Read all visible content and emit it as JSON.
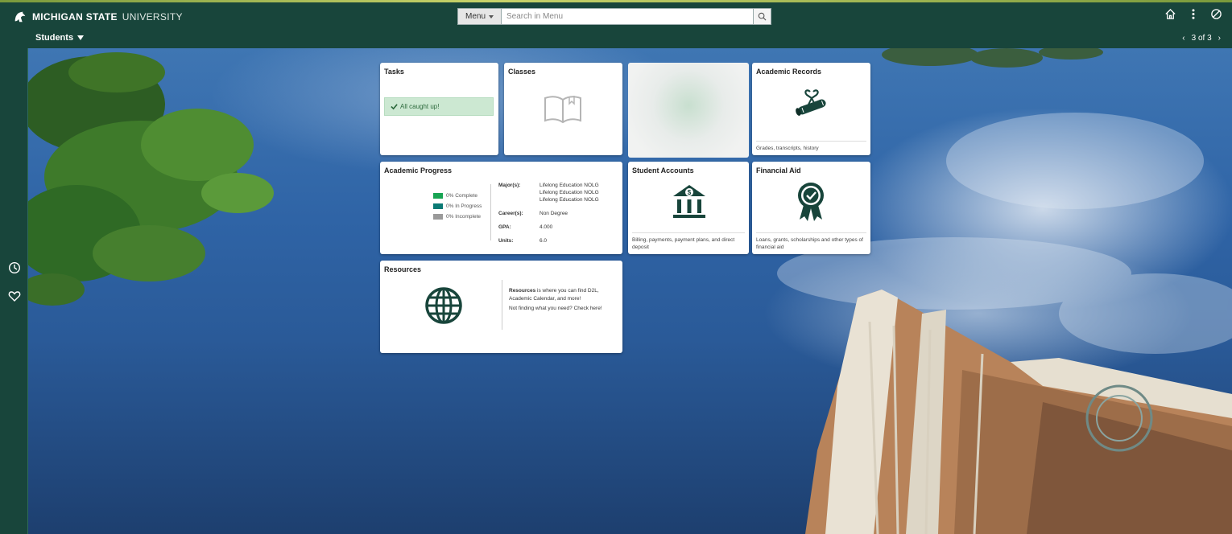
{
  "brand": {
    "name_bold": "MICHIGAN STATE",
    "name_light": "UNIVERSITY"
  },
  "nav": {
    "students_label": "Students"
  },
  "search": {
    "menu_label": "Menu",
    "placeholder": "Search in Menu"
  },
  "pager": {
    "label": "3 of 3"
  },
  "header_icons": [
    "home-icon",
    "more-vertical-icon",
    "nav-bar-icon"
  ],
  "sidebar_icons": [
    "recent-clock-icon",
    "favorites-heart-icon"
  ],
  "colors": {
    "msu_green": "#18453b",
    "tile_icon": "#18453b",
    "complete": "#18a453",
    "in_progress": "#0b7a75",
    "incomplete": "#9a9a9a"
  },
  "tiles": {
    "tasks": {
      "title": "Tasks",
      "status": "All caught up!"
    },
    "classes": {
      "title": "Classes"
    },
    "academic_records": {
      "title": "Academic Records",
      "description": "Grades, transcripts, history"
    },
    "academic_progress": {
      "title": "Academic Progress",
      "legend": [
        {
          "label": "0% Complete",
          "color": "#18a453"
        },
        {
          "label": "0% In Progress",
          "color": "#0b7a75"
        },
        {
          "label": "0% Incomplete",
          "color": "#9a9a9a"
        }
      ],
      "majors_label": "Major(s):",
      "majors": [
        "Lifelong Education NOLG",
        "Lifelong Education NOLG",
        "Lifelong Education NOLG"
      ],
      "careers_label": "Career(s):",
      "career": "Non Degree",
      "gpa_label": "GPA:",
      "gpa": "4.000",
      "units_label": "Units:",
      "units": "6.0"
    },
    "student_accounts": {
      "title": "Student Accounts",
      "description": "Billing, payments, payment plans, and direct deposit"
    },
    "financial_aid": {
      "title": "Financial Aid",
      "description": "Loans, grants, scholarships and other types of financial aid"
    },
    "resources": {
      "title": "Resources",
      "bold": "Resources",
      "text": " is where you can find D2L, Academic Calendar, and more!",
      "text2": "Not finding what you need? Check here!"
    }
  }
}
